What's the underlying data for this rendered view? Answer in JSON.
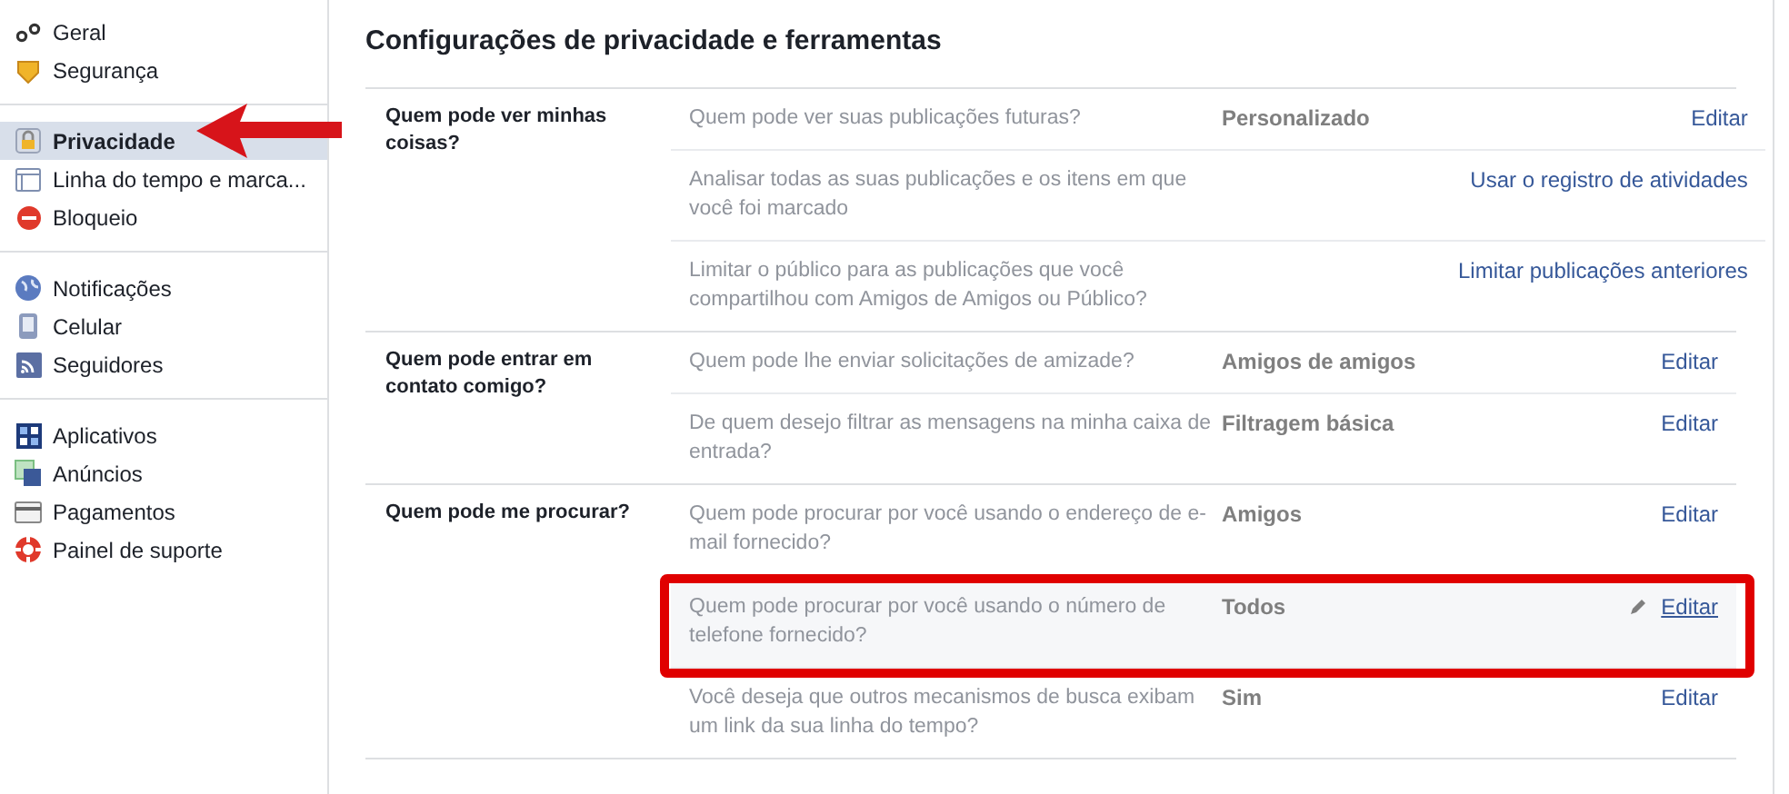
{
  "sidebar": {
    "groups": [
      {
        "items": [
          {
            "label": "Geral",
            "selected": false,
            "arrow": false
          },
          {
            "label": "Segurança",
            "selected": false,
            "arrow": false
          }
        ]
      },
      {
        "items": [
          {
            "label": "Privacidade",
            "selected": true,
            "arrow": true
          },
          {
            "label": "Linha do tempo e marca...",
            "selected": false,
            "arrow": false
          },
          {
            "label": "Bloqueio",
            "selected": false,
            "arrow": false
          }
        ]
      },
      {
        "items": [
          {
            "label": "Notificações",
            "selected": false,
            "arrow": false
          },
          {
            "label": "Celular",
            "selected": false,
            "arrow": false
          },
          {
            "label": "Seguidores",
            "selected": false,
            "arrow": false
          }
        ]
      },
      {
        "items": [
          {
            "label": "Aplicativos",
            "selected": false,
            "arrow": false
          },
          {
            "label": "Anúncios",
            "selected": false,
            "arrow": false
          },
          {
            "label": "Pagamentos",
            "selected": false,
            "arrow": false
          },
          {
            "label": "Painel de suporte",
            "selected": false,
            "arrow": false
          }
        ]
      }
    ]
  },
  "title": "Configurações de privacidade e ferramentas",
  "sections": [
    {
      "label": "Quem pode ver minhas coisas?",
      "rows": [
        {
          "question": "Quem pode ver suas publicações futuras?",
          "value": "Personalizado",
          "action": "Editar",
          "highlighted": false
        },
        {
          "question": "Analisar todas as suas publicações e os itens em que você foi marcado",
          "action": "Usar o registro de atividades",
          "highlighted": false
        },
        {
          "question": "Limitar o público para as publicações que você compartilhou com Amigos de Amigos ou Público?",
          "action": "Limitar publicações anteriores",
          "highlighted": false
        }
      ]
    },
    {
      "label": "Quem pode entrar em contato comigo?",
      "rows": [
        {
          "question": "Quem pode lhe enviar solicitações de amizade?",
          "value": "Amigos de amigos",
          "action": "Editar",
          "highlighted": false
        },
        {
          "question": "De quem desejo filtrar as mensagens na minha caixa de entrada?",
          "value": "Filtragem básica",
          "action": "Editar",
          "highlighted": false
        }
      ]
    },
    {
      "label": "Quem pode me procurar?",
      "rows": [
        {
          "question": "Quem pode procurar por você usando o endereço de e-mail fornecido?",
          "value": "Amigos",
          "action": "Editar",
          "highlighted": false
        },
        {
          "question": "Quem pode procurar por você usando o número de telefone fornecido?",
          "value": "Todos",
          "action": "Editar",
          "highlighted": true
        },
        {
          "question": "Você deseja que outros mecanismos de busca exibam um link da sua linha do tempo?",
          "value": "Sim",
          "action": "Editar",
          "highlighted": false
        }
      ]
    }
  ]
}
